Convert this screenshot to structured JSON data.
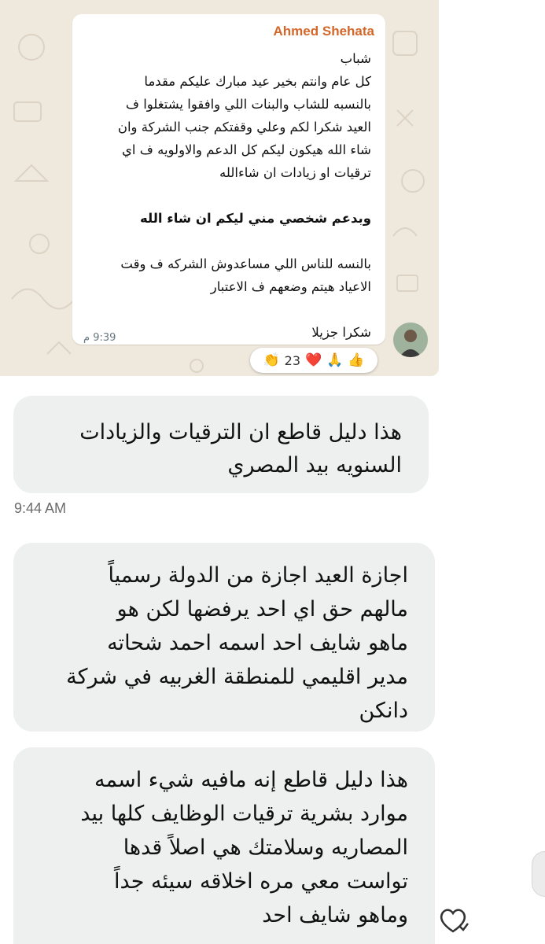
{
  "embedded_screenshot": {
    "sender": "Ahmed Shehata",
    "lines": [
      "شباب",
      "كل عام وانتم بخير عيد مبارك عليكم مقدما",
      "بالنسبه للشاب والبنات اللي وافقوا يشتغلوا ف",
      "العيد شكرا لكم وعلي وقفتكم جنب الشركة وان",
      "شاء الله هيكون ليكم كل الدعم والاولويه ف اي",
      "ترقيات او زيادات ان شاءالله"
    ],
    "bold_line": "وبدعم شخصي مني ليكم ان شاء الله",
    "lines2": [
      "بالنسه للناس اللي مساعدوش الشركه ف وقت",
      "الاعياد هيتم وضعهم ف الاعتبار"
    ],
    "closing": "شكرا جزيلا",
    "time": "9:39 م",
    "reactions": {
      "emojis": [
        "👏",
        "❤️",
        "🙏",
        "👍"
      ],
      "count": "23"
    }
  },
  "messages": [
    {
      "lines": [
        "هذا دليل قاطع ان الترقيات والزيادات",
        "السنويه بيد المصري"
      ]
    },
    {
      "lines": [
        "اجازة العيد اجازة من الدولة رسمياً",
        "مالهم حق اي احد يرفضها لكن هو",
        "ماهو شايف احد اسمه احمد شحاته",
        "مدير اقليمي للمنطقة الغربيه في شركة",
        "دانكن"
      ]
    },
    {
      "lines": [
        "هذا دليل قاطع إنه مافيه شيء اسمه",
        "موارد بشرية ترقيات الوظايف كلها بيد",
        "المصاريه وسلامتك هي اصلاً قدها",
        "تواست معي مره اخلاقه سيئه جداً",
        "وماهو شايف احد"
      ]
    }
  ],
  "timestamp": "9:44 AM",
  "colors": {
    "sender": "#d3672a",
    "wa_background": "#efe8dd",
    "bubble": "#eef0f0"
  }
}
